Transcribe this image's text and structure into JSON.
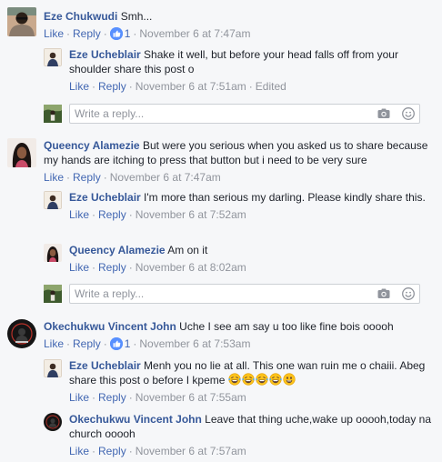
{
  "thread": [
    {
      "author": "Eze Chukwudi",
      "text": "Smh...",
      "like_label": "Like",
      "reply_label": "Reply",
      "like_count": "1",
      "timestamp": "November 6 at 7:47am",
      "replies": [
        {
          "author": "Eze Ucheblair",
          "text": "Shake it well, but before your head falls off from your shoulder share this post o",
          "like_label": "Like",
          "reply_label": "Reply",
          "timestamp": "November 6 at 7:51am",
          "edited_label": "Edited"
        }
      ],
      "reply_box_placeholder": "Write a reply..."
    },
    {
      "author": "Queency Alamezie",
      "text": "But were you serious when you asked us to share because my hands are itching to press that button but i need to be very sure",
      "like_label": "Like",
      "reply_label": "Reply",
      "timestamp": "November 6 at 7:47am",
      "replies": [
        {
          "author": "Eze Ucheblair",
          "text": "I'm more than serious my darling. Please kindly share this.",
          "like_label": "Like",
          "reply_label": "Reply",
          "timestamp": "November 6 at 7:52am"
        },
        {
          "author": "Queency Alamezie",
          "text": "Am on it",
          "like_label": "Like",
          "reply_label": "Reply",
          "timestamp": "November 6 at 8:02am"
        }
      ],
      "reply_box_placeholder": "Write a reply..."
    },
    {
      "author": "Okechukwu Vincent John",
      "text": "Uche I see am say u too like fine bois ooooh",
      "like_label": "Like",
      "reply_label": "Reply",
      "like_count": "1",
      "timestamp": "November 6 at 7:53am",
      "replies": [
        {
          "author": "Eze Ucheblair",
          "text": "Menh you no lie at all. This one wan ruin me o chaiii. Abeg share this post o before I kpeme",
          "emojis": [
            "grinning-tears-emoji",
            "grinning-tears-emoji",
            "grinning-tears-emoji",
            "grinning-tears-emoji",
            "smiley-emoji"
          ],
          "like_label": "Like",
          "reply_label": "Reply",
          "timestamp": "November 6 at 7:55am"
        },
        {
          "author": "Okechukwu Vincent John",
          "text": "Leave that thing uche,wake up ooooh,today na church ooooh",
          "like_label": "Like",
          "reply_label": "Reply",
          "timestamp": "November 6 at 7:57am"
        }
      ]
    }
  ],
  "colors": {
    "background": "#f6f7f9",
    "name_link": "#365899",
    "action_link": "#4267b2",
    "meta_gray": "#90949c",
    "like_badge": "#5890ff",
    "input_border": "#ccd0d5"
  }
}
